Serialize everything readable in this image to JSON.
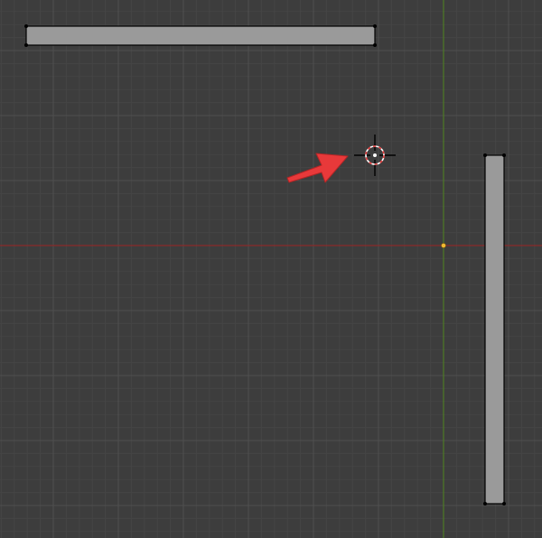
{
  "viewport": {
    "view": "top-orthographic",
    "grid_visible": true,
    "axes": {
      "x_axis_color": "#8a2b2b",
      "y_axis_color": "#4e7a25"
    }
  },
  "colors": {
    "background": "#3d3d3d",
    "grid_minor": "#454545",
    "grid_major": "#4f4f4f",
    "mesh_face": "#9a9a9a",
    "mesh_edge": "#000000",
    "vertex": "#000000",
    "origin_point": "#f0b832",
    "cursor_ring_red": "#e33b3b",
    "cursor_ring_white": "#ffffff",
    "arrow": "#e8393a"
  },
  "scene": {
    "objects": [
      {
        "name": "horizontal-plane",
        "type": "mesh",
        "selected": false
      },
      {
        "name": "vertical-plane",
        "type": "mesh",
        "selected": false
      }
    ],
    "cursor_3d": {
      "icon": "3d-cursor-icon"
    },
    "annotation": {
      "icon": "arrow-pointer-icon"
    },
    "origin": {
      "icon": "origin-dot-icon"
    }
  }
}
